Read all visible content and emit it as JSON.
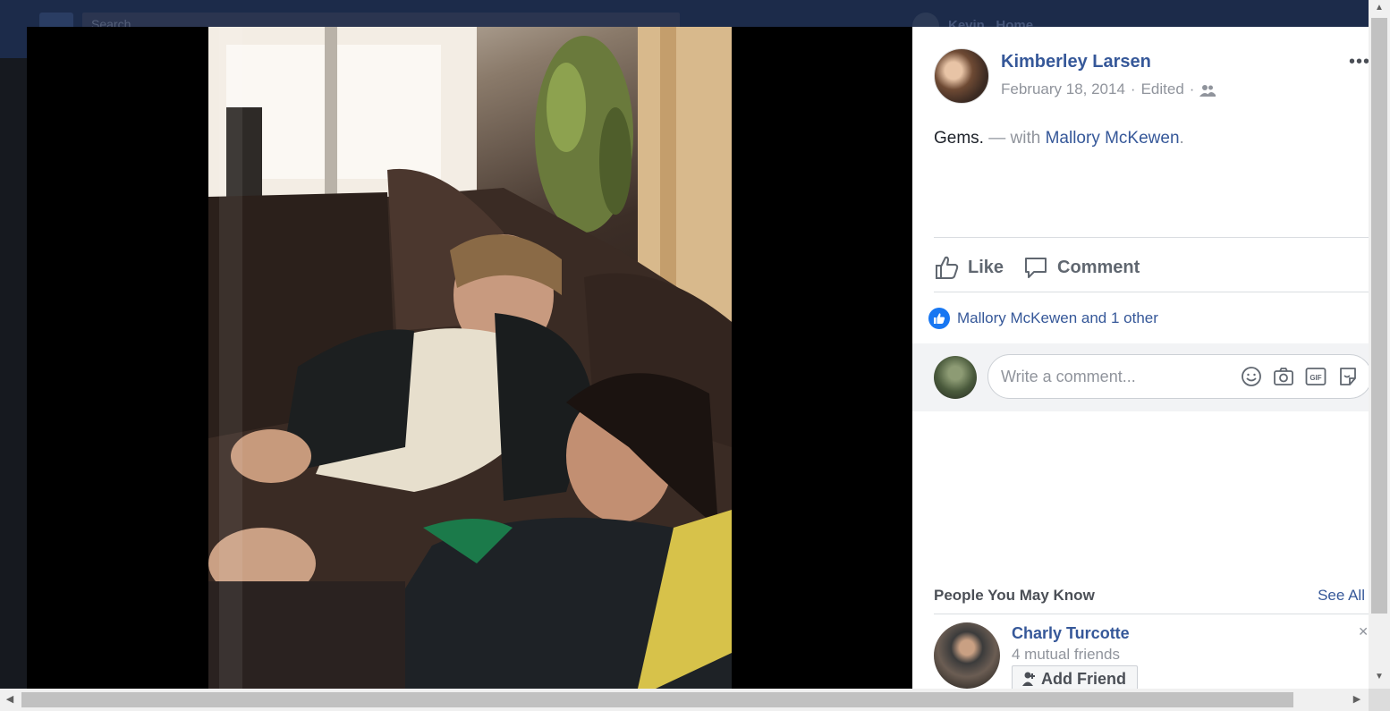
{
  "background": {
    "search_placeholder": "Search",
    "user_name": "Kevin",
    "home_label": "Home"
  },
  "post": {
    "author": "Kimberley Larsen",
    "date": "February 18, 2014",
    "edited": "Edited",
    "text": "Gems.",
    "with_text": "— with",
    "tagged": "Mallory McKewen",
    "tagged_suffix": ".",
    "more_label": "•••"
  },
  "actions": {
    "like": "Like",
    "comment": "Comment"
  },
  "reactions": {
    "summary": "Mallory McKewen and 1 other"
  },
  "comment_box": {
    "placeholder": "Write a comment...",
    "icons": [
      "emoji-icon",
      "camera-icon",
      "gif-icon",
      "sticker-icon"
    ]
  },
  "pymk": {
    "title": "People You May Know",
    "see_all": "See All",
    "person": {
      "name": "Charly Turcotte",
      "mutual": "4 mutual friends",
      "add_label": "Add Friend"
    }
  },
  "colors": {
    "link": "#365899",
    "muted": "#90949c",
    "like_blue": "#1877f2"
  }
}
